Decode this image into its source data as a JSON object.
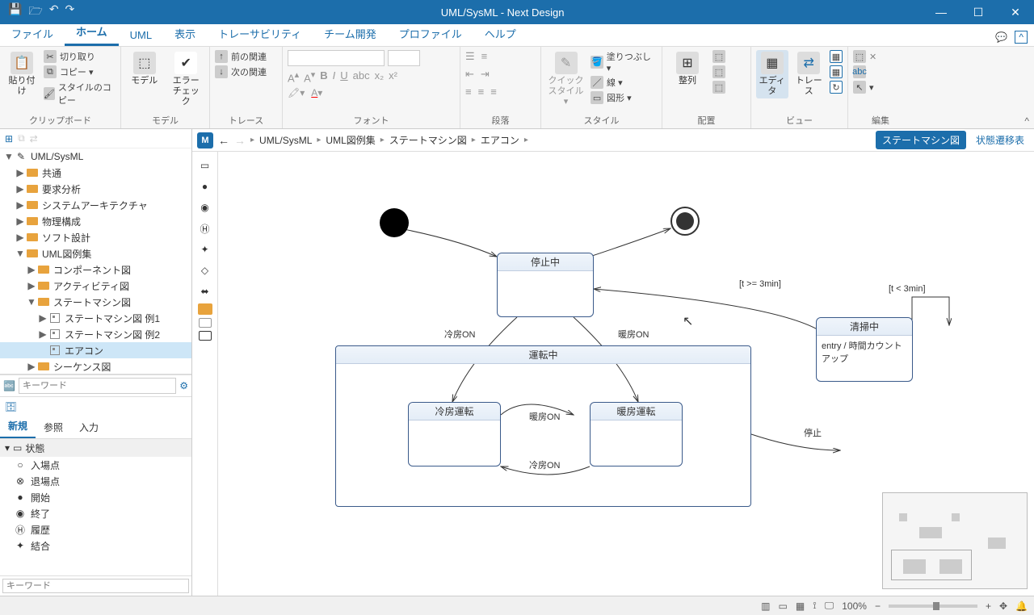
{
  "title": "UML/SysML - Next Design",
  "menu": {
    "file": "ファイル",
    "home": "ホーム",
    "uml": "UML",
    "display": "表示",
    "trace": "トレーサビリティ",
    "team": "チーム開発",
    "profile": "プロファイル",
    "help": "ヘルプ"
  },
  "ribbon": {
    "clipboard": {
      "label": "クリップボード",
      "paste": "貼り付け",
      "cut": "切り取り",
      "copy": "コピー ▾",
      "style": "スタイルのコピー"
    },
    "model": {
      "label": "モデル",
      "model": "モデル",
      "error": "エラーチェック"
    },
    "trace": {
      "label": "トレース",
      "prev": "前の関連",
      "next": "次の関連"
    },
    "font": {
      "label": "フォント"
    },
    "para": {
      "label": "段落"
    },
    "style": {
      "label": "スタイル",
      "quick": "クイック\nスタイル ▾",
      "fill": "塗りつぶし ▾",
      "line": "線 ▾",
      "shape": "図形 ▾"
    },
    "align": {
      "label": "配置",
      "align": "整列"
    },
    "view": {
      "label": "ビュー",
      "editor": "エディタ",
      "trace": "トレース"
    },
    "edit": {
      "label": "編集"
    }
  },
  "tree": {
    "root": "UML/SysML",
    "items": [
      {
        "l": 1,
        "t": "▶",
        "i": "folder",
        "n": "共通"
      },
      {
        "l": 1,
        "t": "▶",
        "i": "folder",
        "n": "要求分析"
      },
      {
        "l": 1,
        "t": "▶",
        "i": "folder",
        "n": "システムアーキテクチャ"
      },
      {
        "l": 1,
        "t": "▶",
        "i": "folder",
        "n": "物理構成"
      },
      {
        "l": 1,
        "t": "▶",
        "i": "folder",
        "n": "ソフト設計"
      },
      {
        "l": 1,
        "t": "▼",
        "i": "folder",
        "n": "UML図例集"
      },
      {
        "l": 2,
        "t": "▶",
        "i": "folder",
        "n": "コンポーネント図"
      },
      {
        "l": 2,
        "t": "▶",
        "i": "folder",
        "n": "アクティビティ図"
      },
      {
        "l": 2,
        "t": "▼",
        "i": "folder",
        "n": "ステートマシン図"
      },
      {
        "l": 3,
        "t": "▶",
        "i": "diag",
        "n": "ステートマシン図 例1"
      },
      {
        "l": 3,
        "t": "▶",
        "i": "diag",
        "n": "ステートマシン図 例2"
      },
      {
        "l": 3,
        "t": "",
        "i": "diag",
        "n": "エアコン",
        "sel": true
      },
      {
        "l": 2,
        "t": "▶",
        "i": "folder",
        "n": "シーケンス図"
      }
    ],
    "search_ph": "キーワード"
  },
  "palette": {
    "tabs": [
      "新規",
      "参照",
      "入力"
    ],
    "group": "状態",
    "items": [
      {
        "ico": "○",
        "n": "入場点"
      },
      {
        "ico": "⊗",
        "n": "退場点"
      },
      {
        "ico": "●",
        "n": "開始"
      },
      {
        "ico": "◉",
        "n": "終了"
      },
      {
        "ico": "Ⓗ",
        "n": "履歴"
      },
      {
        "ico": "✦",
        "n": "結合"
      }
    ],
    "search_ph": "キーワード"
  },
  "breadcrumb": {
    "items": [
      "UML/SysML",
      "UML図例集",
      "ステートマシン図",
      "エアコン"
    ],
    "view_active": "ステートマシン図",
    "view_other": "状態遷移表"
  },
  "diagram": {
    "states": {
      "stopped": "停止中",
      "running": "運転中",
      "cooling": "冷房運転",
      "heating": "暖房運転",
      "cleaning": "清掃中",
      "cleaning_entry": "entry / 時間カウントアップ"
    },
    "labels": {
      "coolon1": "冷房ON",
      "heaton1": "暖房ON",
      "heaton2": "暖房ON",
      "coolon2": "冷房ON",
      "stop": "停止",
      "t_ge": "[t >= 3min]",
      "t_lt": "[t < 3min]"
    }
  },
  "status": {
    "zoom": "100%"
  }
}
